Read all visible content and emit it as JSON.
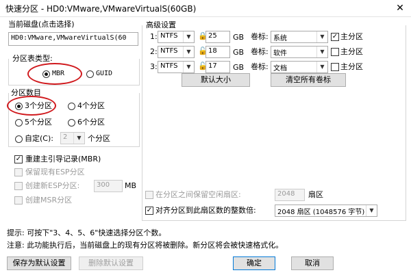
{
  "window": {
    "title": "快速分区 - HD0:VMware,VMwareVirtualS(60GB)",
    "close_glyph": "✕"
  },
  "current_disk": {
    "legend": "当前磁盘(点击选择)",
    "value": "HD0:VMware,VMwareVirtualS(60"
  },
  "partition_table": {
    "legend": "分区表类型:",
    "options": [
      "MBR",
      "GUID"
    ],
    "selected": "MBR"
  },
  "partition_count": {
    "legend": "分区数目",
    "options": [
      "3个分区",
      "4个分区",
      "5个分区",
      "6个分区"
    ],
    "selected": "3个分区",
    "custom_label": "自定(C):",
    "custom_value": "2",
    "custom_unit": "个分区"
  },
  "boot": {
    "rebuild_mbr": "重建主引导记录(MBR)",
    "keep_esp": "保留现有ESP分区",
    "create_esp": "创建新ESP分区:",
    "esp_size": "300",
    "esp_unit": "MB",
    "create_msr": "创建MSR分区"
  },
  "advanced": {
    "legend": "高级设置",
    "size_unit": "GB",
    "label_text": "卷标:",
    "primary_text": "主分区",
    "rows": [
      {
        "index": "1:",
        "fs": "NTFS",
        "size": "25",
        "label": "系统",
        "primary": true
      },
      {
        "index": "2:",
        "fs": "NTFS",
        "size": "18",
        "label": "软件",
        "primary": false
      },
      {
        "index": "3:",
        "fs": "NTFS",
        "size": "17",
        "label": "文档",
        "primary": false
      }
    ],
    "default_size_btn": "默认大小",
    "clear_labels_btn": "清空所有卷标",
    "keep_free_label": "在分区之间保留空闲扇区:",
    "keep_free_value": "2048",
    "keep_free_unit": "扇区",
    "align_label": "对齐分区到此扇区数的整数倍:",
    "align_value": "2048 扇区 (1048576 字节)"
  },
  "hints": {
    "line1": "提示: 可按下\"3、4、5、6\"快速选择分区个数。",
    "line2": "注意: 此功能执行后，当前磁盘上的现有分区将被删除。新分区将会被快速格式化。"
  },
  "buttons": {
    "save_default": "保存为默认设置",
    "delete_default": "删除默认设置",
    "ok": "确定",
    "cancel": "取消"
  },
  "colors": {
    "annotation": "#d0191d",
    "primary_border": "#0078d7"
  }
}
